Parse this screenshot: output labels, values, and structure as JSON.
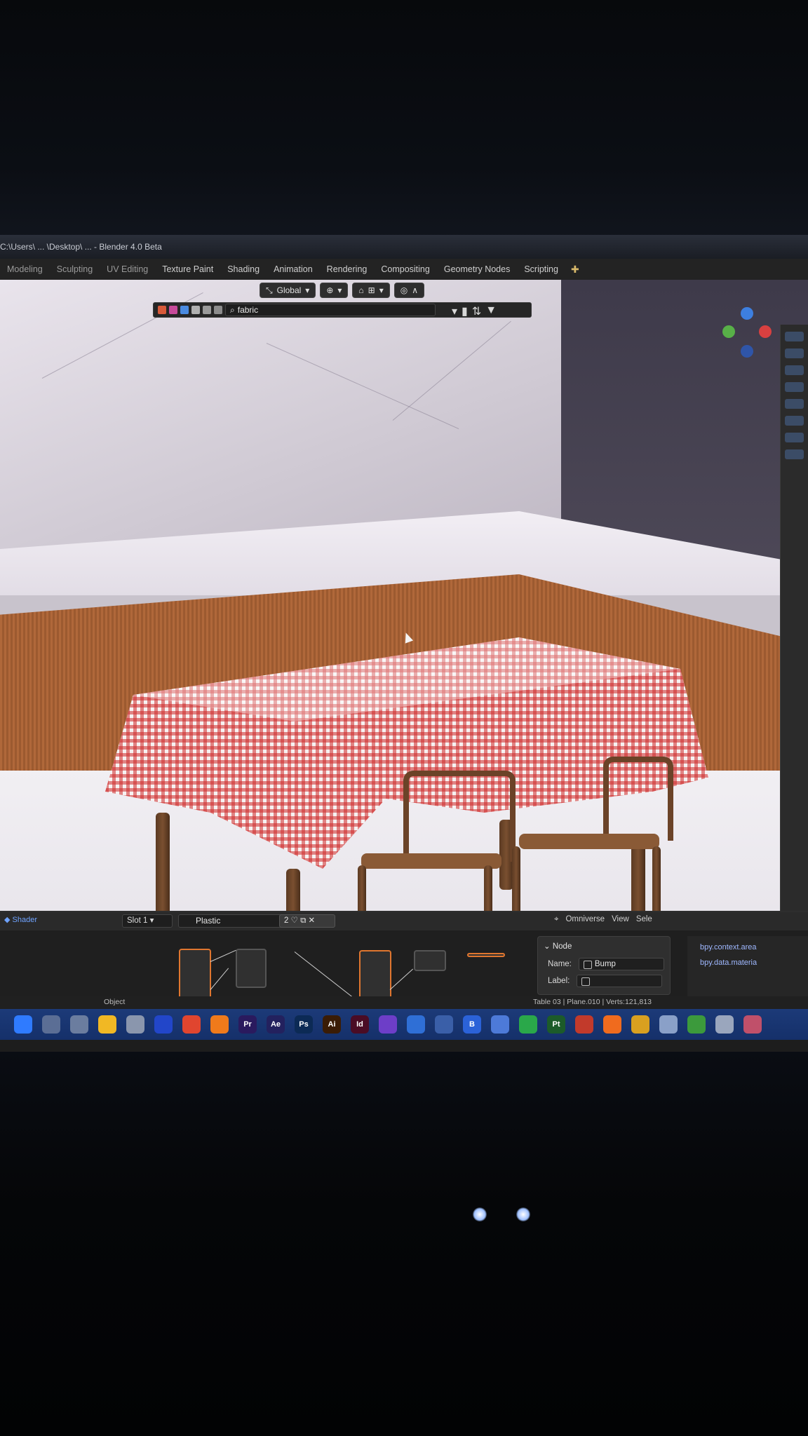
{
  "window": {
    "title": "C:\\Users\\ ... \\Desktop\\ ... - Blender 4.0 Beta"
  },
  "workspaces": [
    "Modeling",
    "Sculpting",
    "UV Editing",
    "Texture Paint",
    "Shading",
    "Animation",
    "Rendering",
    "Compositing",
    "Geometry Nodes",
    "Scripting"
  ],
  "viewport": {
    "transform_orientation": "Global",
    "outliner_search": "fabric"
  },
  "shader_editor": {
    "slot": "Slot 1",
    "material": "Plastic",
    "material_users": "2",
    "header_right": [
      "Omniverse",
      "View",
      "Sele"
    ],
    "node_panel": {
      "header": "Node",
      "name_label": "Name:",
      "name_value": "Bump",
      "label_label": "Label:",
      "label_value": ""
    },
    "python_lines": [
      "bpy.context.area",
      "bpy.data.materia"
    ]
  },
  "status_bar": {
    "left": "Object",
    "right": "Table 03 | Plane.010 | Verts:121,813"
  },
  "taskbar": {
    "icons": [
      {
        "name": "start",
        "label": "",
        "color": "#2f7bff"
      },
      {
        "name": "search",
        "label": "",
        "color": "#5b6e95"
      },
      {
        "name": "task-view",
        "label": "",
        "color": "#6b7d9f"
      },
      {
        "name": "file-explorer",
        "label": "",
        "color": "#f1b824"
      },
      {
        "name": "settings",
        "label": "",
        "color": "#8a96ad"
      },
      {
        "name": "app-blue",
        "label": "",
        "color": "#2246c9"
      },
      {
        "name": "chrome",
        "label": "",
        "color": "#e0452f"
      },
      {
        "name": "firefox",
        "label": "",
        "color": "#f07a1b"
      },
      {
        "name": "premiere",
        "label": "Pr",
        "color": "#2a1a5e"
      },
      {
        "name": "after-effects",
        "label": "Ae",
        "color": "#23215e"
      },
      {
        "name": "photoshop",
        "label": "Ps",
        "color": "#0c2a55"
      },
      {
        "name": "illustrator",
        "label": "Ai",
        "color": "#3a1c05"
      },
      {
        "name": "indesign",
        "label": "Id",
        "color": "#4a0c25"
      },
      {
        "name": "dev-tool",
        "label": "",
        "color": "#6d3ec8"
      },
      {
        "name": "remote",
        "label": "",
        "color": "#2f6fd6"
      },
      {
        "name": "vpn",
        "label": "",
        "color": "#3a5fa8"
      },
      {
        "name": "blender-b",
        "label": "B",
        "color": "#2b62d8"
      },
      {
        "name": "paint",
        "label": "",
        "color": "#4d7ad8"
      },
      {
        "name": "green-app",
        "label": "",
        "color": "#2aa84a"
      },
      {
        "name": "pt",
        "label": "Pt",
        "color": "#1c5b2a"
      },
      {
        "name": "autodesk",
        "label": "",
        "color": "#c23a2b"
      },
      {
        "name": "orange-app",
        "label": "",
        "color": "#f06b1e"
      },
      {
        "name": "chrome-2",
        "label": "",
        "color": "#d9a020"
      },
      {
        "name": "tray-app",
        "label": "",
        "color": "#8aa0c8"
      },
      {
        "name": "green-tray",
        "label": "",
        "color": "#3c9a3c"
      },
      {
        "name": "tray-gear",
        "label": "",
        "color": "#9aa6bd"
      },
      {
        "name": "tray-colorful",
        "label": "",
        "color": "#c0506a"
      }
    ]
  }
}
